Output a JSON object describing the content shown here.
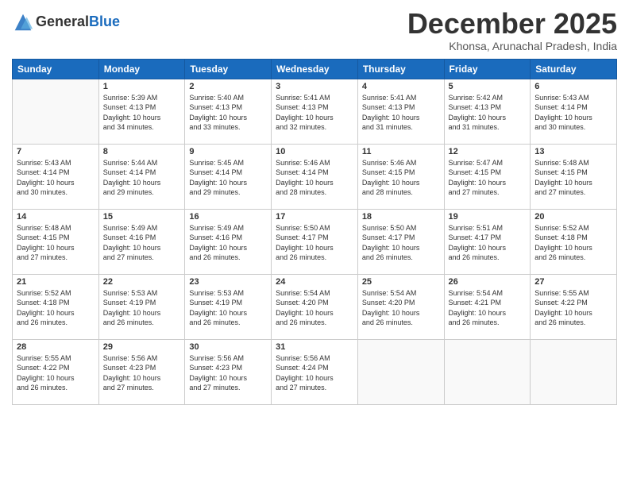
{
  "header": {
    "logo_general": "General",
    "logo_blue": "Blue",
    "month_title": "December 2025",
    "location": "Khonsa, Arunachal Pradesh, India"
  },
  "weekdays": [
    "Sunday",
    "Monday",
    "Tuesday",
    "Wednesday",
    "Thursday",
    "Friday",
    "Saturday"
  ],
  "weeks": [
    [
      {
        "day": "",
        "sunrise": "",
        "sunset": "",
        "daylight": ""
      },
      {
        "day": "1",
        "sunrise": "Sunrise: 5:39 AM",
        "sunset": "Sunset: 4:13 PM",
        "daylight": "Daylight: 10 hours and 34 minutes."
      },
      {
        "day": "2",
        "sunrise": "Sunrise: 5:40 AM",
        "sunset": "Sunset: 4:13 PM",
        "daylight": "Daylight: 10 hours and 33 minutes."
      },
      {
        "day": "3",
        "sunrise": "Sunrise: 5:41 AM",
        "sunset": "Sunset: 4:13 PM",
        "daylight": "Daylight: 10 hours and 32 minutes."
      },
      {
        "day": "4",
        "sunrise": "Sunrise: 5:41 AM",
        "sunset": "Sunset: 4:13 PM",
        "daylight": "Daylight: 10 hours and 31 minutes."
      },
      {
        "day": "5",
        "sunrise": "Sunrise: 5:42 AM",
        "sunset": "Sunset: 4:13 PM",
        "daylight": "Daylight: 10 hours and 31 minutes."
      },
      {
        "day": "6",
        "sunrise": "Sunrise: 5:43 AM",
        "sunset": "Sunset: 4:14 PM",
        "daylight": "Daylight: 10 hours and 30 minutes."
      }
    ],
    [
      {
        "day": "7",
        "sunrise": "Sunrise: 5:43 AM",
        "sunset": "Sunset: 4:14 PM",
        "daylight": "Daylight: 10 hours and 30 minutes."
      },
      {
        "day": "8",
        "sunrise": "Sunrise: 5:44 AM",
        "sunset": "Sunset: 4:14 PM",
        "daylight": "Daylight: 10 hours and 29 minutes."
      },
      {
        "day": "9",
        "sunrise": "Sunrise: 5:45 AM",
        "sunset": "Sunset: 4:14 PM",
        "daylight": "Daylight: 10 hours and 29 minutes."
      },
      {
        "day": "10",
        "sunrise": "Sunrise: 5:46 AM",
        "sunset": "Sunset: 4:14 PM",
        "daylight": "Daylight: 10 hours and 28 minutes."
      },
      {
        "day": "11",
        "sunrise": "Sunrise: 5:46 AM",
        "sunset": "Sunset: 4:15 PM",
        "daylight": "Daylight: 10 hours and 28 minutes."
      },
      {
        "day": "12",
        "sunrise": "Sunrise: 5:47 AM",
        "sunset": "Sunset: 4:15 PM",
        "daylight": "Daylight: 10 hours and 27 minutes."
      },
      {
        "day": "13",
        "sunrise": "Sunrise: 5:48 AM",
        "sunset": "Sunset: 4:15 PM",
        "daylight": "Daylight: 10 hours and 27 minutes."
      }
    ],
    [
      {
        "day": "14",
        "sunrise": "Sunrise: 5:48 AM",
        "sunset": "Sunset: 4:15 PM",
        "daylight": "Daylight: 10 hours and 27 minutes."
      },
      {
        "day": "15",
        "sunrise": "Sunrise: 5:49 AM",
        "sunset": "Sunset: 4:16 PM",
        "daylight": "Daylight: 10 hours and 27 minutes."
      },
      {
        "day": "16",
        "sunrise": "Sunrise: 5:49 AM",
        "sunset": "Sunset: 4:16 PM",
        "daylight": "Daylight: 10 hours and 26 minutes."
      },
      {
        "day": "17",
        "sunrise": "Sunrise: 5:50 AM",
        "sunset": "Sunset: 4:17 PM",
        "daylight": "Daylight: 10 hours and 26 minutes."
      },
      {
        "day": "18",
        "sunrise": "Sunrise: 5:50 AM",
        "sunset": "Sunset: 4:17 PM",
        "daylight": "Daylight: 10 hours and 26 minutes."
      },
      {
        "day": "19",
        "sunrise": "Sunrise: 5:51 AM",
        "sunset": "Sunset: 4:17 PM",
        "daylight": "Daylight: 10 hours and 26 minutes."
      },
      {
        "day": "20",
        "sunrise": "Sunrise: 5:52 AM",
        "sunset": "Sunset: 4:18 PM",
        "daylight": "Daylight: 10 hours and 26 minutes."
      }
    ],
    [
      {
        "day": "21",
        "sunrise": "Sunrise: 5:52 AM",
        "sunset": "Sunset: 4:18 PM",
        "daylight": "Daylight: 10 hours and 26 minutes."
      },
      {
        "day": "22",
        "sunrise": "Sunrise: 5:53 AM",
        "sunset": "Sunset: 4:19 PM",
        "daylight": "Daylight: 10 hours and 26 minutes."
      },
      {
        "day": "23",
        "sunrise": "Sunrise: 5:53 AM",
        "sunset": "Sunset: 4:19 PM",
        "daylight": "Daylight: 10 hours and 26 minutes."
      },
      {
        "day": "24",
        "sunrise": "Sunrise: 5:54 AM",
        "sunset": "Sunset: 4:20 PM",
        "daylight": "Daylight: 10 hours and 26 minutes."
      },
      {
        "day": "25",
        "sunrise": "Sunrise: 5:54 AM",
        "sunset": "Sunset: 4:20 PM",
        "daylight": "Daylight: 10 hours and 26 minutes."
      },
      {
        "day": "26",
        "sunrise": "Sunrise: 5:54 AM",
        "sunset": "Sunset: 4:21 PM",
        "daylight": "Daylight: 10 hours and 26 minutes."
      },
      {
        "day": "27",
        "sunrise": "Sunrise: 5:55 AM",
        "sunset": "Sunset: 4:22 PM",
        "daylight": "Daylight: 10 hours and 26 minutes."
      }
    ],
    [
      {
        "day": "28",
        "sunrise": "Sunrise: 5:55 AM",
        "sunset": "Sunset: 4:22 PM",
        "daylight": "Daylight: 10 hours and 26 minutes."
      },
      {
        "day": "29",
        "sunrise": "Sunrise: 5:56 AM",
        "sunset": "Sunset: 4:23 PM",
        "daylight": "Daylight: 10 hours and 27 minutes."
      },
      {
        "day": "30",
        "sunrise": "Sunrise: 5:56 AM",
        "sunset": "Sunset: 4:23 PM",
        "daylight": "Daylight: 10 hours and 27 minutes."
      },
      {
        "day": "31",
        "sunrise": "Sunrise: 5:56 AM",
        "sunset": "Sunset: 4:24 PM",
        "daylight": "Daylight: 10 hours and 27 minutes."
      },
      {
        "day": "",
        "sunrise": "",
        "sunset": "",
        "daylight": ""
      },
      {
        "day": "",
        "sunrise": "",
        "sunset": "",
        "daylight": ""
      },
      {
        "day": "",
        "sunrise": "",
        "sunset": "",
        "daylight": ""
      }
    ]
  ]
}
